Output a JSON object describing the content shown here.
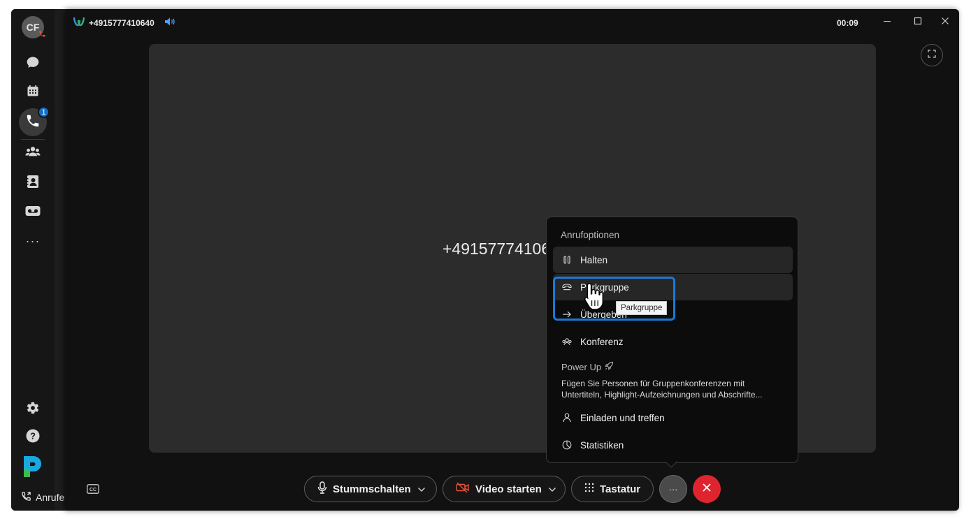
{
  "sidebar": {
    "avatar_initials": "CF",
    "calls_badge": "1",
    "bottom_label": "Anrufe",
    "items": [
      {
        "name": "messaging",
        "icon": "chat-icon"
      },
      {
        "name": "meetings",
        "icon": "calendar-icon"
      },
      {
        "name": "calling",
        "icon": "phone-icon"
      },
      {
        "name": "teams",
        "icon": "people-icon"
      },
      {
        "name": "contacts",
        "icon": "contacts-icon"
      },
      {
        "name": "voicemail",
        "icon": "voicemail-icon"
      }
    ],
    "more": "···"
  },
  "call_window": {
    "title_number": "+4915777410640",
    "timer": "00:09",
    "caller_display": "+4915777410640"
  },
  "controls": {
    "mute_label": "Stummschalten",
    "video_label": "Video starten",
    "keypad_label": "Tastatur",
    "more_label": "···"
  },
  "menu": {
    "title": "Anrufoptionen",
    "items": {
      "hold": "Halten",
      "park": "Parkgruppe",
      "transfer": "Übergeben",
      "conference": "Konferenz",
      "invite": "Einladen und treffen",
      "stats": "Statistiken"
    },
    "powerup_title": "Power Up",
    "powerup_desc": "Fügen Sie Personen für Gruppenkonferenzen mit Untertiteln, Highlight-Aufzeichnungen und Abschrifte..."
  },
  "tooltip": "Parkgruppe",
  "colors": {
    "accent_blue": "#1a7ad6",
    "end_call_red": "#e0242f",
    "badge_blue": "#1170cf",
    "app_bg": "#1d1d1d"
  }
}
